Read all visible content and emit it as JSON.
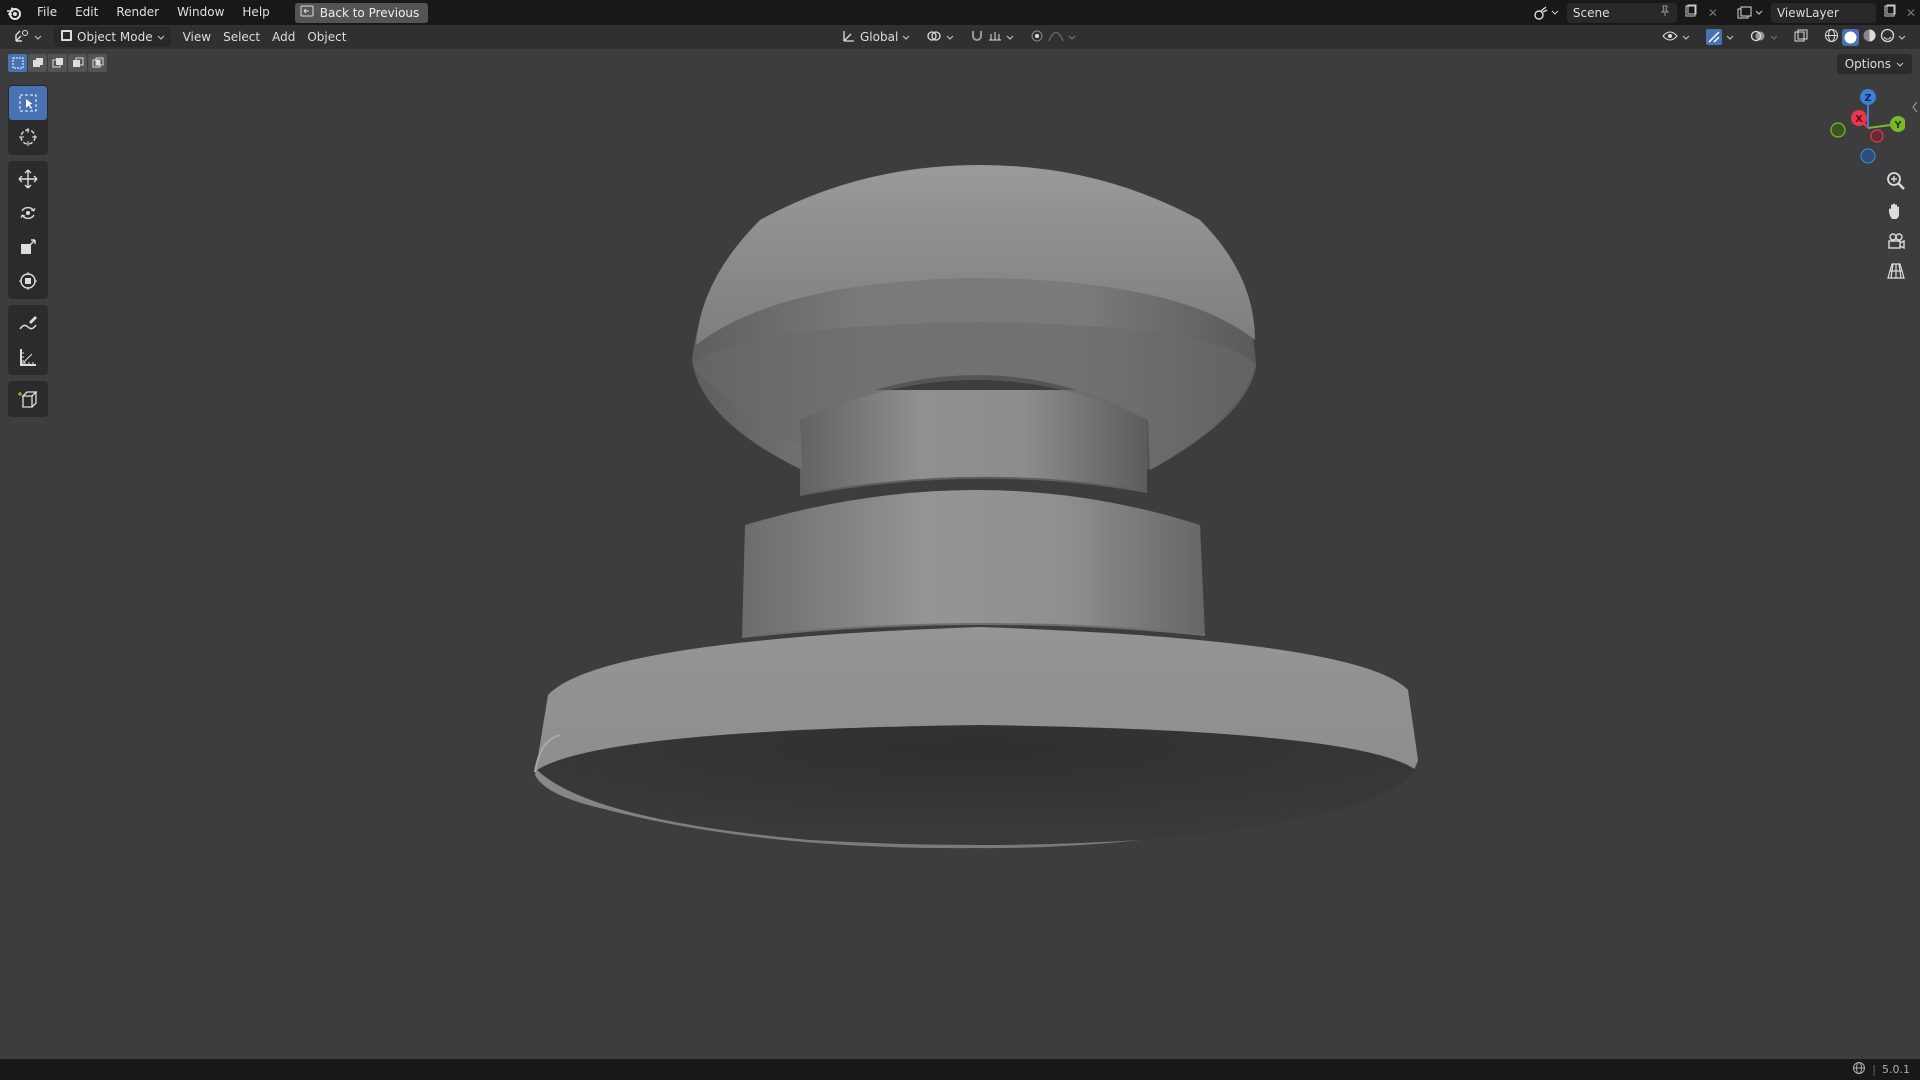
{
  "menu": {
    "file": "File",
    "edit": "Edit",
    "render": "Render",
    "window": "Window",
    "help": "Help",
    "back_to_previous": "Back to Previous"
  },
  "topbar_right": {
    "scene": "Scene",
    "view_layer": "ViewLayer"
  },
  "header": {
    "mode": "Object Mode",
    "view": "View",
    "select": "Select",
    "add": "Add",
    "object": "Object",
    "orientation": "Global"
  },
  "viewport": {
    "options": "Options",
    "gizmo": {
      "x": "X",
      "y": "Y",
      "z": "Z"
    }
  },
  "statusbar": {
    "version": "5.0.1"
  },
  "colors": {
    "accent": "#4772b3",
    "axis_x": "#e8384f",
    "axis_y": "#7cb82f",
    "axis_z": "#3b7fd9"
  }
}
